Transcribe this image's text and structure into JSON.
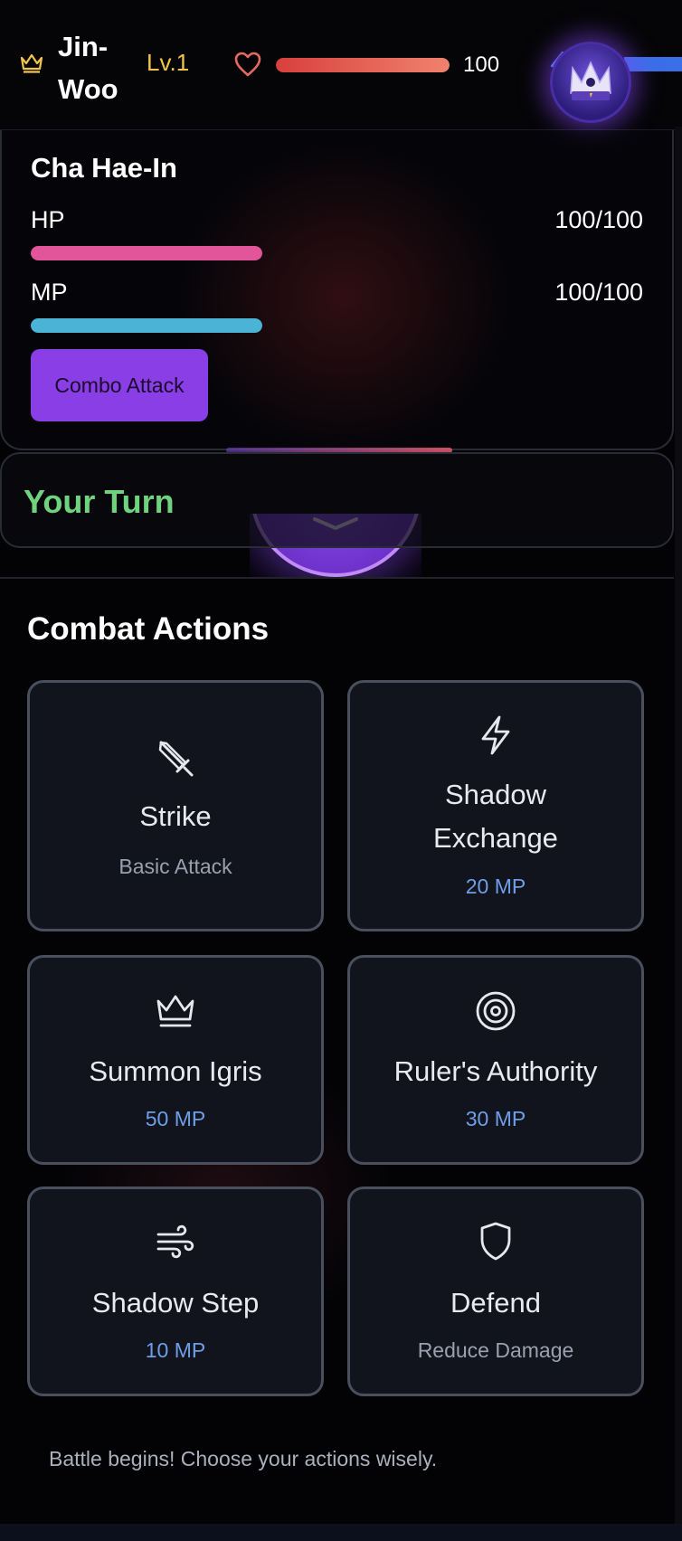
{
  "header": {
    "player_name": "Jin-Woo",
    "level": "Lv.1",
    "hp_value": "100",
    "hp_fraction": 1.0
  },
  "ally": {
    "name": "Cha Hae-In",
    "hp_label": "HP",
    "hp_value": "100/100",
    "mp_label": "MP",
    "mp_value": "100/100",
    "combo_button": "Combo Attack"
  },
  "turn": {
    "text": "Your Turn"
  },
  "combat": {
    "title": "Combat Actions",
    "actions": [
      {
        "name": "Strike",
        "sub": "Basic Attack",
        "icon": "sword-icon"
      },
      {
        "name": "Shadow Exchange",
        "sub": "20 MP",
        "icon": "lightning-icon"
      },
      {
        "name": "Summon Igris",
        "sub": "50 MP",
        "icon": "crown-icon"
      },
      {
        "name": "Ruler's Authority",
        "sub": "30 MP",
        "icon": "target-icon"
      },
      {
        "name": "Shadow Step",
        "sub": "10 MP",
        "icon": "wind-icon"
      },
      {
        "name": "Defend",
        "sub": "Reduce Damage",
        "icon": "shield-icon"
      }
    ]
  },
  "log": {
    "message": "Battle begins! Choose your actions wisely."
  },
  "colors": {
    "accent_purple": "#8a3ee6",
    "level_gold": "#f1c54c",
    "turn_green": "#6fd37d",
    "hp_red": "#d8403d",
    "ally_hp_pink": "#e2559a",
    "ally_mp_cyan": "#4ab3d6",
    "mp_cost_blue": "#6f9ee8"
  }
}
